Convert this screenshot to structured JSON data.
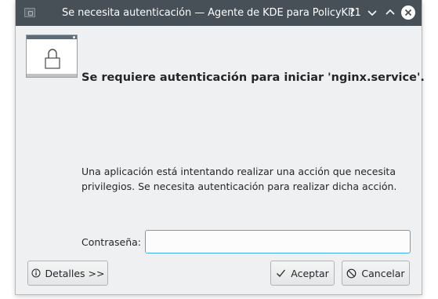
{
  "window": {
    "title": "Se necesita autenticación — Agente de KDE para PolicyKit1",
    "help_glyph": "?",
    "icons": [
      "app-icon",
      "help-icon",
      "minimize-icon",
      "maximize-icon",
      "close-icon"
    ]
  },
  "dialog": {
    "icon": "lock-icon",
    "heading": "Se requiere autenticación para iniciar 'nginx.service'.",
    "message": "Una aplicación está intentando realizar una acción que necesita privilegios. Se necesita autenticación para realizar dicha acción.",
    "password_label": "Contraseña:",
    "password_value": ""
  },
  "buttons": {
    "details": "Detalles >>",
    "accept": "Aceptar",
    "cancel": "Cancelar"
  },
  "colors": {
    "titlebar": "#475057",
    "focus_border": "#3daee9",
    "window_bg": "#eff0f1"
  }
}
